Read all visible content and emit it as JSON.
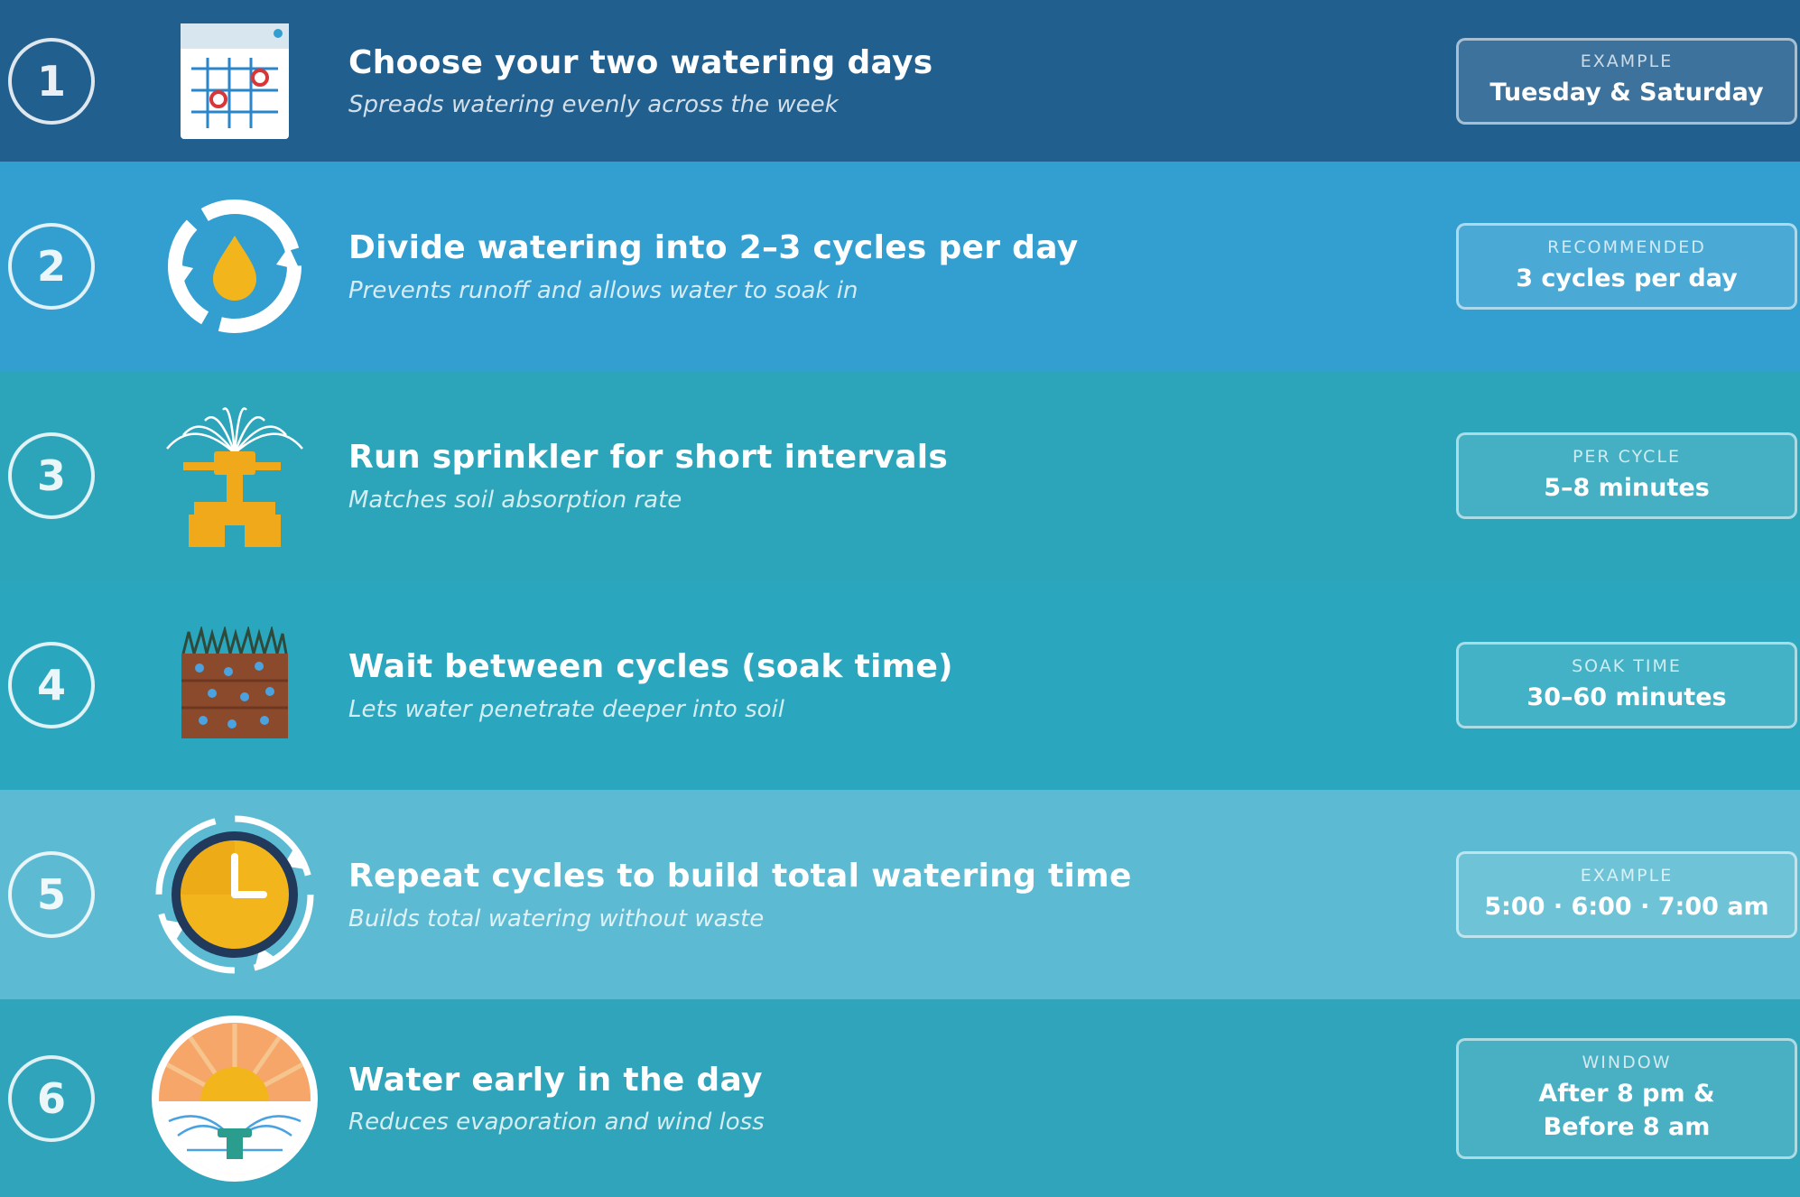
{
  "colors": {
    "step1": "#215f8f",
    "step2": "#329fd0",
    "step3": "#2ca5bb",
    "step4": "#2aa7bf",
    "step5": "#5cbbd2",
    "step6": "#30a4bb",
    "accent_orange": "#f0a91b",
    "soil_brown": "#8b4a2b"
  },
  "steps": [
    {
      "number": "1",
      "icon": "calendar-icon",
      "title": "Choose your two watering days",
      "subtitle": "Spreads watering evenly across the week",
      "badge_label": "EXAMPLE",
      "badge_value": "Tuesday & Saturday"
    },
    {
      "number": "2",
      "icon": "water-cycle-icon",
      "title": "Divide watering into 2–3 cycles per day",
      "subtitle": "Prevents runoff and allows water to soak in",
      "badge_label": "RECOMMENDED",
      "badge_value": "3 cycles per day"
    },
    {
      "number": "3",
      "icon": "sprinkler-icon",
      "title": "Run sprinkler for short intervals",
      "subtitle": "Matches soil absorption rate",
      "badge_label": "PER CYCLE",
      "badge_value": "5–8 minutes"
    },
    {
      "number": "4",
      "icon": "soil-icon",
      "title": "Wait between cycles (soak time)",
      "subtitle": "Lets water penetrate deeper into soil",
      "badge_label": "SOAK TIME",
      "badge_value": "30–60 minutes"
    },
    {
      "number": "5",
      "icon": "clock-icon",
      "title": "Repeat cycles to build total watering time",
      "subtitle": "Builds total watering without waste",
      "badge_label": "EXAMPLE",
      "badge_value": "5:00 · 6:00 · 7:00 am"
    },
    {
      "number": "6",
      "icon": "sunrise-sprinkler-icon",
      "title": "Water early in the day",
      "subtitle": "Reduces evaporation and wind loss",
      "badge_label": "WINDOW",
      "badge_value_line1": "After 8 pm &",
      "badge_value_line2": "Before 8 am"
    }
  ]
}
